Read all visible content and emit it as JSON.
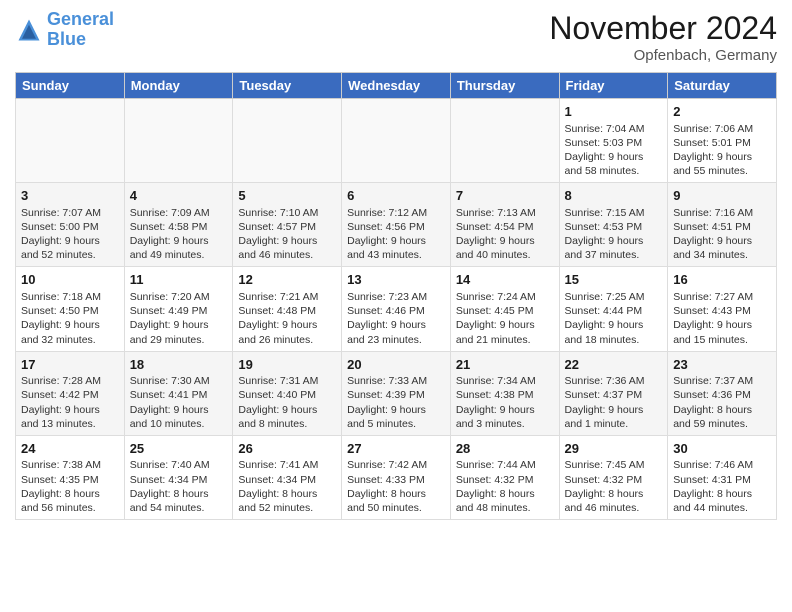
{
  "logo": {
    "line1": "General",
    "line2": "Blue"
  },
  "title": "November 2024",
  "subtitle": "Opfenbach, Germany",
  "days_header": [
    "Sunday",
    "Monday",
    "Tuesday",
    "Wednesday",
    "Thursday",
    "Friday",
    "Saturday"
  ],
  "weeks": [
    [
      {
        "day": "",
        "info": ""
      },
      {
        "day": "",
        "info": ""
      },
      {
        "day": "",
        "info": ""
      },
      {
        "day": "",
        "info": ""
      },
      {
        "day": "",
        "info": ""
      },
      {
        "day": "1",
        "info": "Sunrise: 7:04 AM\nSunset: 5:03 PM\nDaylight: 9 hours and 58 minutes."
      },
      {
        "day": "2",
        "info": "Sunrise: 7:06 AM\nSunset: 5:01 PM\nDaylight: 9 hours and 55 minutes."
      }
    ],
    [
      {
        "day": "3",
        "info": "Sunrise: 7:07 AM\nSunset: 5:00 PM\nDaylight: 9 hours and 52 minutes."
      },
      {
        "day": "4",
        "info": "Sunrise: 7:09 AM\nSunset: 4:58 PM\nDaylight: 9 hours and 49 minutes."
      },
      {
        "day": "5",
        "info": "Sunrise: 7:10 AM\nSunset: 4:57 PM\nDaylight: 9 hours and 46 minutes."
      },
      {
        "day": "6",
        "info": "Sunrise: 7:12 AM\nSunset: 4:56 PM\nDaylight: 9 hours and 43 minutes."
      },
      {
        "day": "7",
        "info": "Sunrise: 7:13 AM\nSunset: 4:54 PM\nDaylight: 9 hours and 40 minutes."
      },
      {
        "day": "8",
        "info": "Sunrise: 7:15 AM\nSunset: 4:53 PM\nDaylight: 9 hours and 37 minutes."
      },
      {
        "day": "9",
        "info": "Sunrise: 7:16 AM\nSunset: 4:51 PM\nDaylight: 9 hours and 34 minutes."
      }
    ],
    [
      {
        "day": "10",
        "info": "Sunrise: 7:18 AM\nSunset: 4:50 PM\nDaylight: 9 hours and 32 minutes."
      },
      {
        "day": "11",
        "info": "Sunrise: 7:20 AM\nSunset: 4:49 PM\nDaylight: 9 hours and 29 minutes."
      },
      {
        "day": "12",
        "info": "Sunrise: 7:21 AM\nSunset: 4:48 PM\nDaylight: 9 hours and 26 minutes."
      },
      {
        "day": "13",
        "info": "Sunrise: 7:23 AM\nSunset: 4:46 PM\nDaylight: 9 hours and 23 minutes."
      },
      {
        "day": "14",
        "info": "Sunrise: 7:24 AM\nSunset: 4:45 PM\nDaylight: 9 hours and 21 minutes."
      },
      {
        "day": "15",
        "info": "Sunrise: 7:25 AM\nSunset: 4:44 PM\nDaylight: 9 hours and 18 minutes."
      },
      {
        "day": "16",
        "info": "Sunrise: 7:27 AM\nSunset: 4:43 PM\nDaylight: 9 hours and 15 minutes."
      }
    ],
    [
      {
        "day": "17",
        "info": "Sunrise: 7:28 AM\nSunset: 4:42 PM\nDaylight: 9 hours and 13 minutes."
      },
      {
        "day": "18",
        "info": "Sunrise: 7:30 AM\nSunset: 4:41 PM\nDaylight: 9 hours and 10 minutes."
      },
      {
        "day": "19",
        "info": "Sunrise: 7:31 AM\nSunset: 4:40 PM\nDaylight: 9 hours and 8 minutes."
      },
      {
        "day": "20",
        "info": "Sunrise: 7:33 AM\nSunset: 4:39 PM\nDaylight: 9 hours and 5 minutes."
      },
      {
        "day": "21",
        "info": "Sunrise: 7:34 AM\nSunset: 4:38 PM\nDaylight: 9 hours and 3 minutes."
      },
      {
        "day": "22",
        "info": "Sunrise: 7:36 AM\nSunset: 4:37 PM\nDaylight: 9 hours and 1 minute."
      },
      {
        "day": "23",
        "info": "Sunrise: 7:37 AM\nSunset: 4:36 PM\nDaylight: 8 hours and 59 minutes."
      }
    ],
    [
      {
        "day": "24",
        "info": "Sunrise: 7:38 AM\nSunset: 4:35 PM\nDaylight: 8 hours and 56 minutes."
      },
      {
        "day": "25",
        "info": "Sunrise: 7:40 AM\nSunset: 4:34 PM\nDaylight: 8 hours and 54 minutes."
      },
      {
        "day": "26",
        "info": "Sunrise: 7:41 AM\nSunset: 4:34 PM\nDaylight: 8 hours and 52 minutes."
      },
      {
        "day": "27",
        "info": "Sunrise: 7:42 AM\nSunset: 4:33 PM\nDaylight: 8 hours and 50 minutes."
      },
      {
        "day": "28",
        "info": "Sunrise: 7:44 AM\nSunset: 4:32 PM\nDaylight: 8 hours and 48 minutes."
      },
      {
        "day": "29",
        "info": "Sunrise: 7:45 AM\nSunset: 4:32 PM\nDaylight: 8 hours and 46 minutes."
      },
      {
        "day": "30",
        "info": "Sunrise: 7:46 AM\nSunset: 4:31 PM\nDaylight: 8 hours and 44 minutes."
      }
    ]
  ]
}
